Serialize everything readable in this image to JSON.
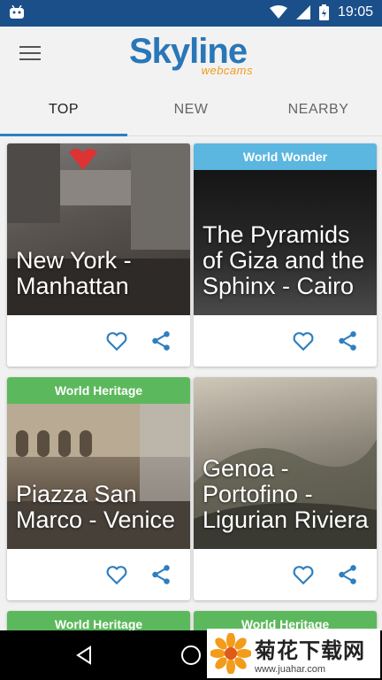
{
  "status_bar": {
    "time": "19:05",
    "battery_glyph": "battery-icon",
    "wifi_glyph": "wifi-icon",
    "signal_glyph": "signal-icon"
  },
  "app": {
    "logo_word": "Skyline",
    "logo_sub": "webcams"
  },
  "tabs": [
    {
      "label": "TOP",
      "active": true
    },
    {
      "label": "NEW",
      "active": false
    },
    {
      "label": "NEARBY",
      "active": false
    }
  ],
  "cards": [
    {
      "title": "New York - Manhattan",
      "label": "",
      "label_color": ""
    },
    {
      "title": "The Pyramids of Giza and the Sphinx - Cairo",
      "label": "World Wonder",
      "label_color": "#5bb6e0"
    },
    {
      "title": "Piazza San Marco - Venice",
      "label": "World Heritage",
      "label_color": "#5cb85c"
    },
    {
      "title": "Genoa - Portofino - Ligurian Riviera",
      "label": "",
      "label_color": ""
    },
    {
      "title": "",
      "label": "World Heritage",
      "label_color": "#5cb85c"
    },
    {
      "title": "",
      "label": "World Heritage",
      "label_color": "#5cb85c"
    }
  ],
  "watermark": {
    "main": "菊花下载网",
    "url": "www.juahar.com"
  }
}
